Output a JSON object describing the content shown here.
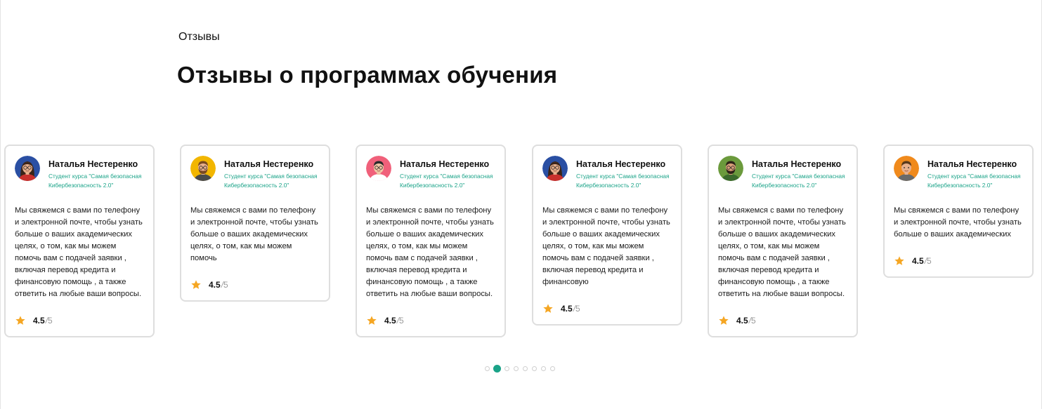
{
  "section": {
    "eyebrow": "Отзывы",
    "title": "Отзывы о программах обучения"
  },
  "reviews": [
    {
      "name": "Наталья Нестеренко",
      "course": "Студент курса \"Самая безопасная Кибербезопасность 2.0\"",
      "text": "Мы свяжемся с вами по телефону и электронной почте, чтобы узнать больше о ваших академических целях, о том, как мы можем помочь вам с подачей заявки , включая перевод кредита и финансовую помощь , а также ответить на любые ваши вопросы.",
      "rating": "4.5",
      "rating_sep": "/",
      "rating_max": "5",
      "avatar_bg": "#2a4fa3",
      "avatar_person": "woman-glasses"
    },
    {
      "name": "Наталья Нестеренко",
      "course": "Студент курса \"Самая безопасная Кибербезопасность 2.0\"",
      "text": "Мы свяжемся с вами по телефону и электронной почте, чтобы узнать больше о ваших академических целях, о том, как мы можем помочь",
      "rating": "4.5",
      "rating_sep": "/",
      "rating_max": "5",
      "avatar_bg": "#f2b600",
      "avatar_person": "man-beard-glasses"
    },
    {
      "name": "Наталья Нестеренко",
      "course": "Студент курса \"Самая безопасная Кибербезопасность 2.0\"",
      "text": "Мы свяжемся с вами по телефону и электронной почте, чтобы узнать больше о ваших академических целях, о том, как мы можем помочь вам с подачей заявки , включая перевод кредита и финансовую помощь , а также ответить на любые ваши вопросы.",
      "rating": "4.5",
      "rating_sep": "/",
      "rating_max": "5",
      "avatar_bg": "#f0607a",
      "avatar_person": "man-curly"
    },
    {
      "name": "Наталья Нестеренко",
      "course": "Студент курса \"Самая безопасная Кибербезопасность 2.0\"",
      "text": "Мы свяжемся с вами по телефону и электронной почте, чтобы узнать больше о ваших академических целях, о том, как мы можем помочь вам с подачей заявки , включая перевод кредита и финансовую",
      "rating": "4.5",
      "rating_sep": "/",
      "rating_max": "5",
      "avatar_bg": "#2a4fa3",
      "avatar_person": "woman-glasses"
    },
    {
      "name": "Наталья Нестеренко",
      "course": "Студент курса \"Самая безопасная Кибербезопасность 2.0\"",
      "text": "Мы свяжемся с вами по телефону и электронной почте, чтобы узнать больше о ваших академических целях, о том, как мы можем помочь вам с подачей заявки , включая перевод кредита и финансовую помощь , а также ответить на любые ваши вопросы.",
      "rating": "4.5",
      "rating_sep": "/",
      "rating_max": "5",
      "avatar_bg": "#6b9a3c",
      "avatar_person": "man-beard"
    },
    {
      "name": "Наталья Нестеренко",
      "course": "Студент курса \"Самая безопасная Кибербезопасность 2.0\"",
      "text": "Мы свяжемся с вами по телефону и электронной почте, чтобы узнать больше о ваших академических",
      "rating": "4.5",
      "rating_sep": "/",
      "rating_max": "5",
      "avatar_bg": "#f08a1c",
      "avatar_person": "man-smile"
    }
  ],
  "pagination": {
    "count": 8,
    "active_index": 1
  },
  "colors": {
    "accent": "#1aa388",
    "star": "#f5a623",
    "card_border": "#dedede"
  }
}
